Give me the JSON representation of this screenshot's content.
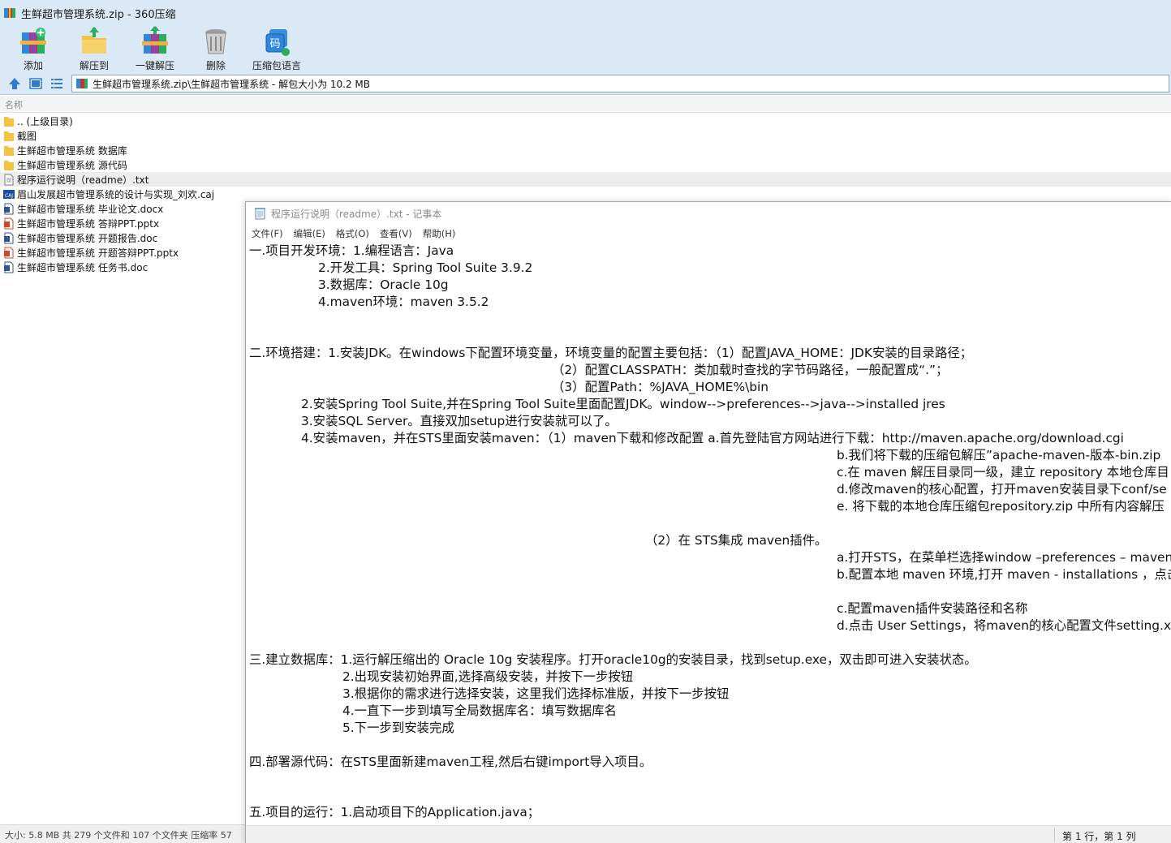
{
  "zip": {
    "title": "生鲜超市管理系统.zip - 360压缩",
    "toolbar": [
      {
        "label": "添加",
        "icon": "add-archive-icon"
      },
      {
        "label": "解压到",
        "icon": "extract-to-icon"
      },
      {
        "label": "一键解压",
        "icon": "one-click-extract-icon"
      },
      {
        "label": "删除",
        "icon": "delete-trash-icon"
      },
      {
        "label": "压缩包语言",
        "icon": "archive-language-icon"
      }
    ],
    "path": "生鲜超市管理系统.zip\\生鲜超市管理系统 - 解包大小为 10.2 MB",
    "column_name": "名称",
    "files": [
      {
        "name": ".. (上级目录)",
        "icon": "folder-up-icon"
      },
      {
        "name": "截图",
        "icon": "folder-icon"
      },
      {
        "name": "生鲜超市管理系统 数据库",
        "icon": "folder-icon"
      },
      {
        "name": "生鲜超市管理系统 源代码",
        "icon": "folder-icon"
      },
      {
        "name": "程序运行说明（readme）.txt",
        "icon": "text-file-icon",
        "selected": true
      },
      {
        "name": "眉山发展超市管理系统的设计与实现_刘欢.caj",
        "icon": "caj-file-icon"
      },
      {
        "name": "生鲜超市管理系统 毕业论文.docx",
        "icon": "word-file-icon"
      },
      {
        "name": "生鲜超市管理系统 答辩PPT.pptx",
        "icon": "powerpoint-file-icon"
      },
      {
        "name": "生鲜超市管理系统 开题报告.doc",
        "icon": "word-file-icon"
      },
      {
        "name": "生鲜超市管理系统 开题答辩PPT.pptx",
        "icon": "powerpoint-file-icon"
      },
      {
        "name": "生鲜超市管理系统 任务书.doc",
        "icon": "word-file-icon"
      }
    ],
    "status": "大小: 5.8 MB 共 279 个文件和 107 个文件夹 压缩率 57"
  },
  "notepad": {
    "title": "程序运行说明（readme）.txt - 记事本",
    "menu": [
      "文件(F)",
      "编辑(E)",
      "格式(O)",
      "查看(V)",
      "帮助(H)"
    ],
    "lines": [
      "一.项目开发环境：1.编程语言：Java",
      "2.开发工具：Spring Tool Suite 3.9.2",
      "3.数据库：Oracle 10g",
      "4.maven环境：maven 3.5.2",
      "二.环境搭建：1.安装JDK。在windows下配置环境变量，环境变量的配置主要包括：（1）配置JAVA_HOME：JDK安装的目录路径；",
      "（2）配置CLASSPATH：类加载时查找的字节码路径，一般配置成“.”；",
      "（3）配置Path：%JAVA_HOME%\\bin",
      "2.安装Spring Tool Suite,并在Spring Tool Suite里面配置JDK。window-->preferences-->java-->installed jres",
      "3.安装SQL Server。直接双加setup进行安装就可以了。",
      "4.安装maven，并在STS里面安装maven：（1）maven下载和修改配置 a.首先登陆官方网站进行下载：http://maven.apache.org/download.cgi",
      "b.我们将下载的压缩包解压”apache-maven-版本-bin.zip",
      "c.在 maven 解压目录同一级，建立 repository 本地仓库目",
      "d.修改maven的核心配置，打开maven安装目录下conf/se",
      "e. 将下载的本地仓库压缩包repository.zip 中所有内容解压",
      "（2）在 STS集成 maven插件。",
      "a.打开STS，在菜单栏选择window –preferences – maven",
      "b.配置本地 maven 环境,打开 maven - installations ，点击",
      "c.配置maven插件安装路径和名称",
      "d.点击 User Settings，将maven的核心配置文件setting.xml",
      "三.建立数据库：1.运行解压缩出的 Oracle 10g 安装程序。打开oracle10g的安装目录，找到setup.exe，双击即可进入安装状态。",
      "2.出现安装初始界面,选择高级安装，并按下一步按钮",
      "3.根据你的需求进行选择安装，这里我们选择标准版，并按下一步按钮",
      "4.一直下一步到填写全局数据库名：填写数据库名",
      "5.下一步到安装完成",
      "四.部署源代码：在STS里面新建maven工程,然后右键import导入项目。",
      "五.项目的运行：1.启动项目下的Application.java；"
    ],
    "status_position": "第 1 行，第 1 列"
  }
}
